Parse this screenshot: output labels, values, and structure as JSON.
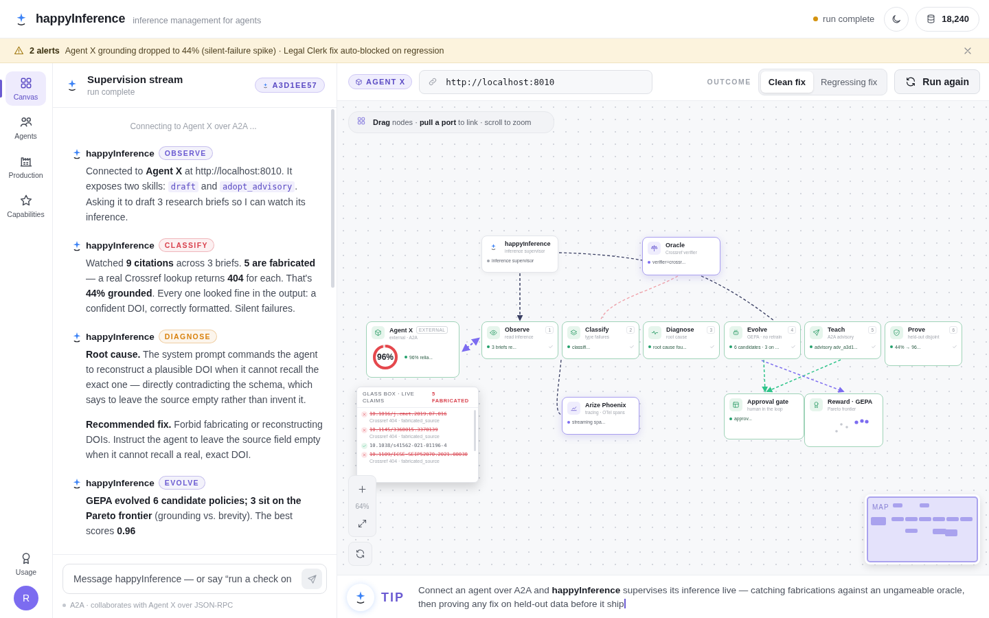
{
  "header": {
    "app_name": "happyInference",
    "tagline": "inference management for agents",
    "status": {
      "label": "run complete",
      "color": "#d4930f"
    },
    "tokens": "18,240"
  },
  "alert": {
    "count": "2 alerts",
    "message": "Agent X grounding dropped to 44% (silent-failure spike) · Legal Clerk fix auto-blocked on regression"
  },
  "rail": {
    "items": [
      {
        "label": "Canvas",
        "selected": true
      },
      {
        "label": "Agents",
        "selected": false
      },
      {
        "label": "Production",
        "selected": false
      },
      {
        "label": "Capabilities",
        "selected": false
      }
    ],
    "usage": "Usage",
    "avatar": "R"
  },
  "chat": {
    "title": "Supervision stream",
    "subtitle": "run complete",
    "run_id": "A3D1EE57",
    "notice": "Connecting to Agent X over A2A ...",
    "messages": [
      {
        "author": "happyInference",
        "stage": "OBSERVE",
        "color": "#6b5bd2",
        "paragraphs": [
          [
            {
              "kind": "text",
              "text": "Connected to **Agent X** at http://localhost:8010. It exposes two skills: "
            },
            {
              "kind": "code",
              "text": "draft"
            },
            {
              "kind": "text",
              "text": " and "
            },
            {
              "kind": "code",
              "text": "adopt_advisory"
            },
            {
              "kind": "text",
              "text": ". Asking it to draft 3 research briefs so I can watch its inference."
            }
          ]
        ]
      },
      {
        "author": "happyInference",
        "stage": "CLASSIFY",
        "color": "#d9434f",
        "paragraphs": [
          [
            {
              "kind": "text",
              "text": "Watched **9 citations** across 3 briefs. **5 are fabricated** — a real Crossref lookup returns **404** for each. That's **44% grounded**. Every one looked fine in the output: a confident DOI, correctly formatted. Silent failures."
            }
          ]
        ]
      },
      {
        "author": "happyInference",
        "stage": "DIAGNOSE",
        "color": "#d9820f",
        "paragraphs": [
          [
            {
              "kind": "text",
              "text": "**Root cause.** The system prompt commands the agent to reconstruct a plausible DOI when it cannot recall the exact one — directly contradicting the schema, which says to leave the source empty rather than invent it."
            }
          ],
          [
            {
              "kind": "text",
              "text": "**Recommended fix.** Forbid fabricating or reconstructing DOIs. Instruct the agent to leave the source field empty when it cannot recall a real, exact DOI."
            }
          ]
        ]
      },
      {
        "author": "happyInference",
        "stage": "EVOLVE",
        "color": "#6b5bd2",
        "paragraphs": [
          [
            {
              "kind": "text",
              "text": "**GEPA evolved 6 candidate policies; 3 sit on the Pareto frontier** (grounding vs. brevity). The best scores **0.96**"
            }
          ]
        ]
      }
    ],
    "composer": {
      "placeholder": "Message happyInference — or say “run a check on",
      "note": "A2A · collaborates with Agent X over JSON-RPC"
    }
  },
  "canvas": {
    "agent": "AGENT X",
    "url": "http://localhost:8010",
    "outcome_label": "OUTCOME",
    "outcomes": [
      {
        "label": "Clean fix",
        "selected": true
      },
      {
        "label": "Regressing fix",
        "selected": false
      }
    ],
    "run_button": "Run again",
    "hint": "**Drag** nodes · **pull a port** to link · scroll to zoom",
    "nodes": [
      {
        "kind": "supervisor",
        "title": "happyInference",
        "subtitle": "inference supervisor",
        "status": "inference supervisor",
        "color": "#a0a4ad"
      },
      {
        "kind": "service",
        "title": "Oracle",
        "subtitle": "Crossref verifier",
        "status": "verifier=crossr...",
        "color": "#7c6cf0"
      },
      {
        "kind": "agent",
        "title": "Agent X",
        "badge": "EXTERNAL",
        "subtitle": "external · A2A",
        "status": "96% relia...",
        "color": "#22a06b",
        "ring": {
          "label": "96%",
          "level": 0.96
        }
      },
      {
        "kind": "step",
        "title": "Observe",
        "subtitle": "read inference",
        "step": "1",
        "status": "3 briefs re...",
        "color": "#22a06b",
        "done": true
      },
      {
        "kind": "step",
        "title": "Classify",
        "subtitle": "type failures",
        "step": "2",
        "status": "classifi...",
        "color": "#22a06b",
        "done": true
      },
      {
        "kind": "step",
        "title": "Diagnose",
        "subtitle": "root cause",
        "step": "3",
        "status": "root cause fou...",
        "color": "#22a06b",
        "done": true
      },
      {
        "kind": "step",
        "title": "Evolve",
        "subtitle": "GEPA · no retrain",
        "step": "4",
        "status": "6 candidates · 3 on ...",
        "color": "#22a06b",
        "done": true
      },
      {
        "kind": "step",
        "title": "Teach",
        "subtitle": "A2A advisory",
        "step": "5",
        "status": "advisory adv_a3d1...",
        "color": "#22a06b",
        "done": true
      },
      {
        "kind": "step",
        "title": "Prove",
        "subtitle": "held-out disjoint",
        "step": "6",
        "status": "44% → 96...",
        "color": "#22a06b",
        "done": true
      },
      {
        "kind": "gate",
        "title": "Approval gate",
        "subtitle": "human in the loop",
        "status": "approv...",
        "color": "#22a06b"
      },
      {
        "kind": "reward",
        "title": "Reward · GEPA",
        "subtitle": "Pareto frontier"
      },
      {
        "kind": "service",
        "title": "Arize Phoenix",
        "subtitle": "tracing · OTel spans",
        "status": "streaming spa...",
        "color": "#7c6cf0"
      }
    ],
    "glass_box": {
      "title": "GLASS BOX · LIVE CLAIMS",
      "count": "5 FABRICATED",
      "claims": [
        {
          "doi": "10.1016/j.cmet.2019.07.016",
          "verified": false,
          "note": "Crossref 404 · fabricated_source"
        },
        {
          "doi": "10.1145/3368015.3370139",
          "verified": false,
          "note": "Crossref 404 · fabricated_source"
        },
        {
          "doi": "10.1038/s41562-021-01196-4",
          "verified": true
        },
        {
          "doi": "10.1109/ICSE-SEIP52070.2021.00030",
          "verified": false,
          "note": "Crossref 404 · fabricated_source"
        }
      ]
    },
    "zoom": "64%",
    "minimap": "MAP"
  },
  "tip": {
    "label": "TIP",
    "text": "Connect an agent over A2A and **happyInference** supervises its inference live — catching fabrications against an ungameable oracle, then proving any fix on held-out data before it ship"
  }
}
